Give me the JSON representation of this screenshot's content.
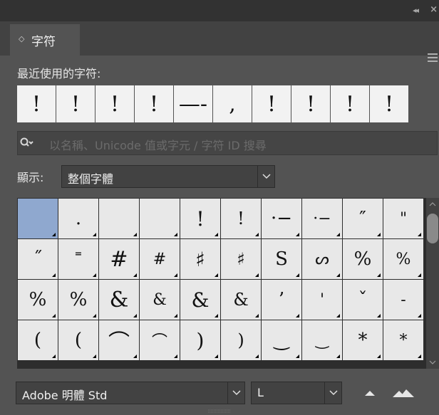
{
  "window": {
    "collapse_icon": "double-chevron-left-icon",
    "close_icon": "close-icon"
  },
  "panel": {
    "tab_label": "字符",
    "menu_icon": "hamburger-menu-icon"
  },
  "recent": {
    "title": "最近使用的字符:",
    "glyphs": [
      "!",
      "!",
      "!",
      "!",
      "—-",
      ",",
      "!",
      "!",
      "!",
      "!"
    ]
  },
  "search": {
    "placeholder": "以名稱、Unicode 值或字元 / 字符 ID 搜尋",
    "icon": "search-icon"
  },
  "show": {
    "label": "顯示:",
    "value": "整個字體"
  },
  "grid": {
    "selected_index": 0,
    "rows": [
      [
        " ",
        ".",
        " ",
        " ",
        "!",
        "!",
        "·−",
        "·−",
        "″",
        "\""
      ],
      [
        "˝",
        "˭",
        "#",
        "#",
        "♯",
        "♯",
        "S",
        "ᔕ",
        "%",
        "%"
      ],
      [
        "%",
        "%",
        "&",
        "&",
        "&",
        "&",
        "’",
        "'",
        "ˇ",
        "-"
      ],
      [
        "(",
        "(",
        "⌒",
        "⌒",
        ")",
        ")",
        "‿",
        "‿",
        "*",
        "*"
      ]
    ]
  },
  "font": {
    "family": "Adobe 明體 Std",
    "style": "L"
  },
  "colors": {
    "panel_bg": "#535353",
    "cell_bg": "#e8e8e8",
    "selected_cell": "#8fa8cf"
  }
}
